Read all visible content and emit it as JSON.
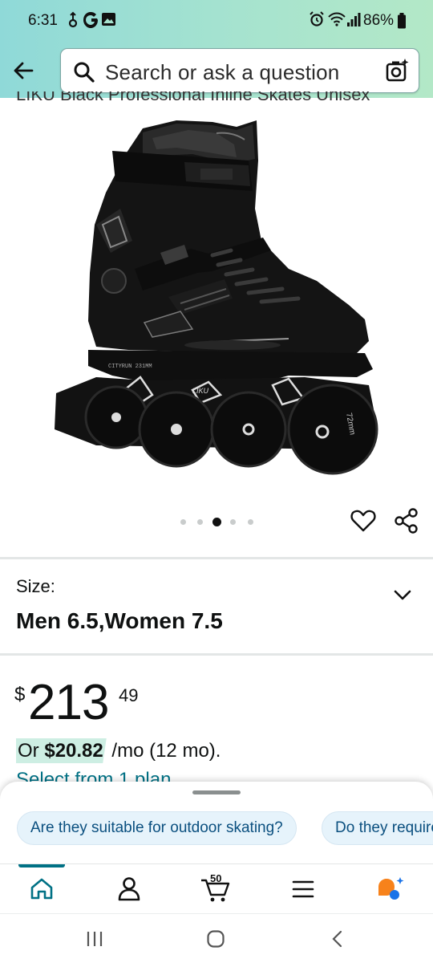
{
  "status_bar": {
    "time": "6:31",
    "battery": "86%",
    "icons": [
      "usb-icon",
      "google-g-icon",
      "gallery-icon",
      "alarm-icon",
      "wifi-icon",
      "signal-icon",
      "battery-icon"
    ]
  },
  "search": {
    "placeholder": "Search or ask a question"
  },
  "product": {
    "title_partial": "LIKU Black Professional Inline Skates Unisex",
    "image_alt": "Black inline skate",
    "carousel": {
      "count": 5,
      "active_index": 2
    }
  },
  "size": {
    "label": "Size:",
    "value": "Men 6.5,Women 7.5"
  },
  "price": {
    "currency": "$",
    "whole": "213",
    "fraction": "49",
    "monthly_prefix": "Or",
    "monthly_amount": "$20.82",
    "monthly_suffix": " /mo (12 mo).",
    "plan_link": "Select from 1 plan"
  },
  "questions": {
    "chips": [
      "Are they suitable for outdoor skating?",
      "Do they require"
    ]
  },
  "bottom_nav": {
    "items": [
      "home-icon",
      "account-icon",
      "cart-icon",
      "menu-icon",
      "rufus-icon"
    ],
    "cart_count": "50",
    "active": "home"
  },
  "colors": {
    "header_gradient_start": "#8fd9d8",
    "header_gradient_end": "#b3e8c7",
    "link": "#007185",
    "monthly_highlight": "#cdeee3",
    "chip_bg": "#e6f3fb",
    "chip_text": "#0a4f7f",
    "rufus_orange": "#f7821b",
    "rufus_blue": "#1a73e8"
  }
}
